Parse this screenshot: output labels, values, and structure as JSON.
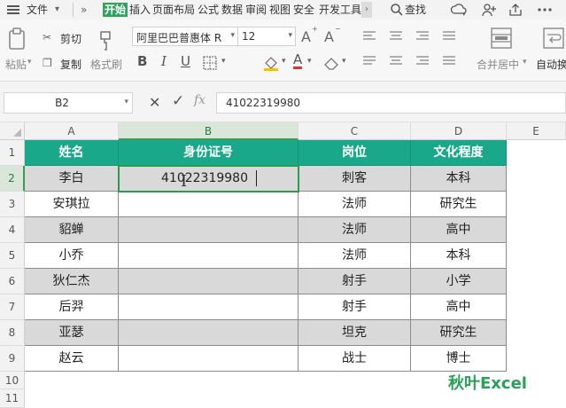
{
  "menubar": {
    "file_label": "文件",
    "more_glyph": "»",
    "tabs": [
      {
        "label": "开始",
        "active": true
      },
      {
        "label": "插入",
        "active": false
      },
      {
        "label": "页面布局",
        "active": false
      },
      {
        "label": "公式",
        "active": false
      },
      {
        "label": "数据",
        "active": false
      },
      {
        "label": "审阅",
        "active": false
      },
      {
        "label": "视图",
        "active": false
      },
      {
        "label": "安全",
        "active": false
      },
      {
        "label": "开发工具",
        "active": false
      }
    ],
    "search_label": "查找",
    "right_icons": [
      "cloud-sync-icon",
      "user-share-icon",
      "share-icon",
      "more-dots-icon"
    ]
  },
  "ribbon": {
    "paste_label": "粘贴",
    "cut_label": "剪切",
    "copy_label": "复制",
    "format_painter_label": "格式刷",
    "font_name": "阿里巴巴普惠体 R",
    "font_size": "12",
    "bold_glyph": "B",
    "italic_glyph": "I",
    "underline_glyph": "U",
    "font_color_glyph": "A",
    "grow_font_glyph": "A",
    "shrink_font_glyph": "A",
    "merge_center_label": "合并居中",
    "wrap_label": "自动换",
    "accent_color": "#2fa35f",
    "font_color": "#e03131"
  },
  "formula": {
    "name_box": "B2",
    "cancel_glyph": "✕",
    "confirm_glyph": "✓",
    "fx_glyph": "fx",
    "value": "41022319980"
  },
  "grid": {
    "columns": [
      "A",
      "B",
      "C",
      "D",
      "E"
    ],
    "selected_column": "B",
    "rows": [
      "1",
      "2",
      "3",
      "4",
      "5",
      "6",
      "7",
      "8",
      "9",
      "10",
      "11"
    ],
    "selected_row": "2",
    "header": [
      "姓名",
      "身份证号",
      "岗位",
      "文化程度"
    ],
    "data": [
      [
        "李白",
        "41022319980",
        "刺客",
        "本科"
      ],
      [
        "安琪拉",
        "",
        "法师",
        "研究生"
      ],
      [
        "貂蝉",
        "",
        "法师",
        "高中"
      ],
      [
        "小乔",
        "",
        "法师",
        "本科"
      ],
      [
        "狄仁杰",
        "",
        "射手",
        "小学"
      ],
      [
        "后羿",
        "",
        "射手",
        "高中"
      ],
      [
        "亚瑟",
        "",
        "坦克",
        "研究生"
      ],
      [
        "赵云",
        "",
        "战士",
        "博士"
      ]
    ],
    "header_color": "#1aa88a",
    "band_color": "#d9d9d9",
    "active_border_color": "#2c9b50"
  },
  "watermark": "秋叶Excel"
}
